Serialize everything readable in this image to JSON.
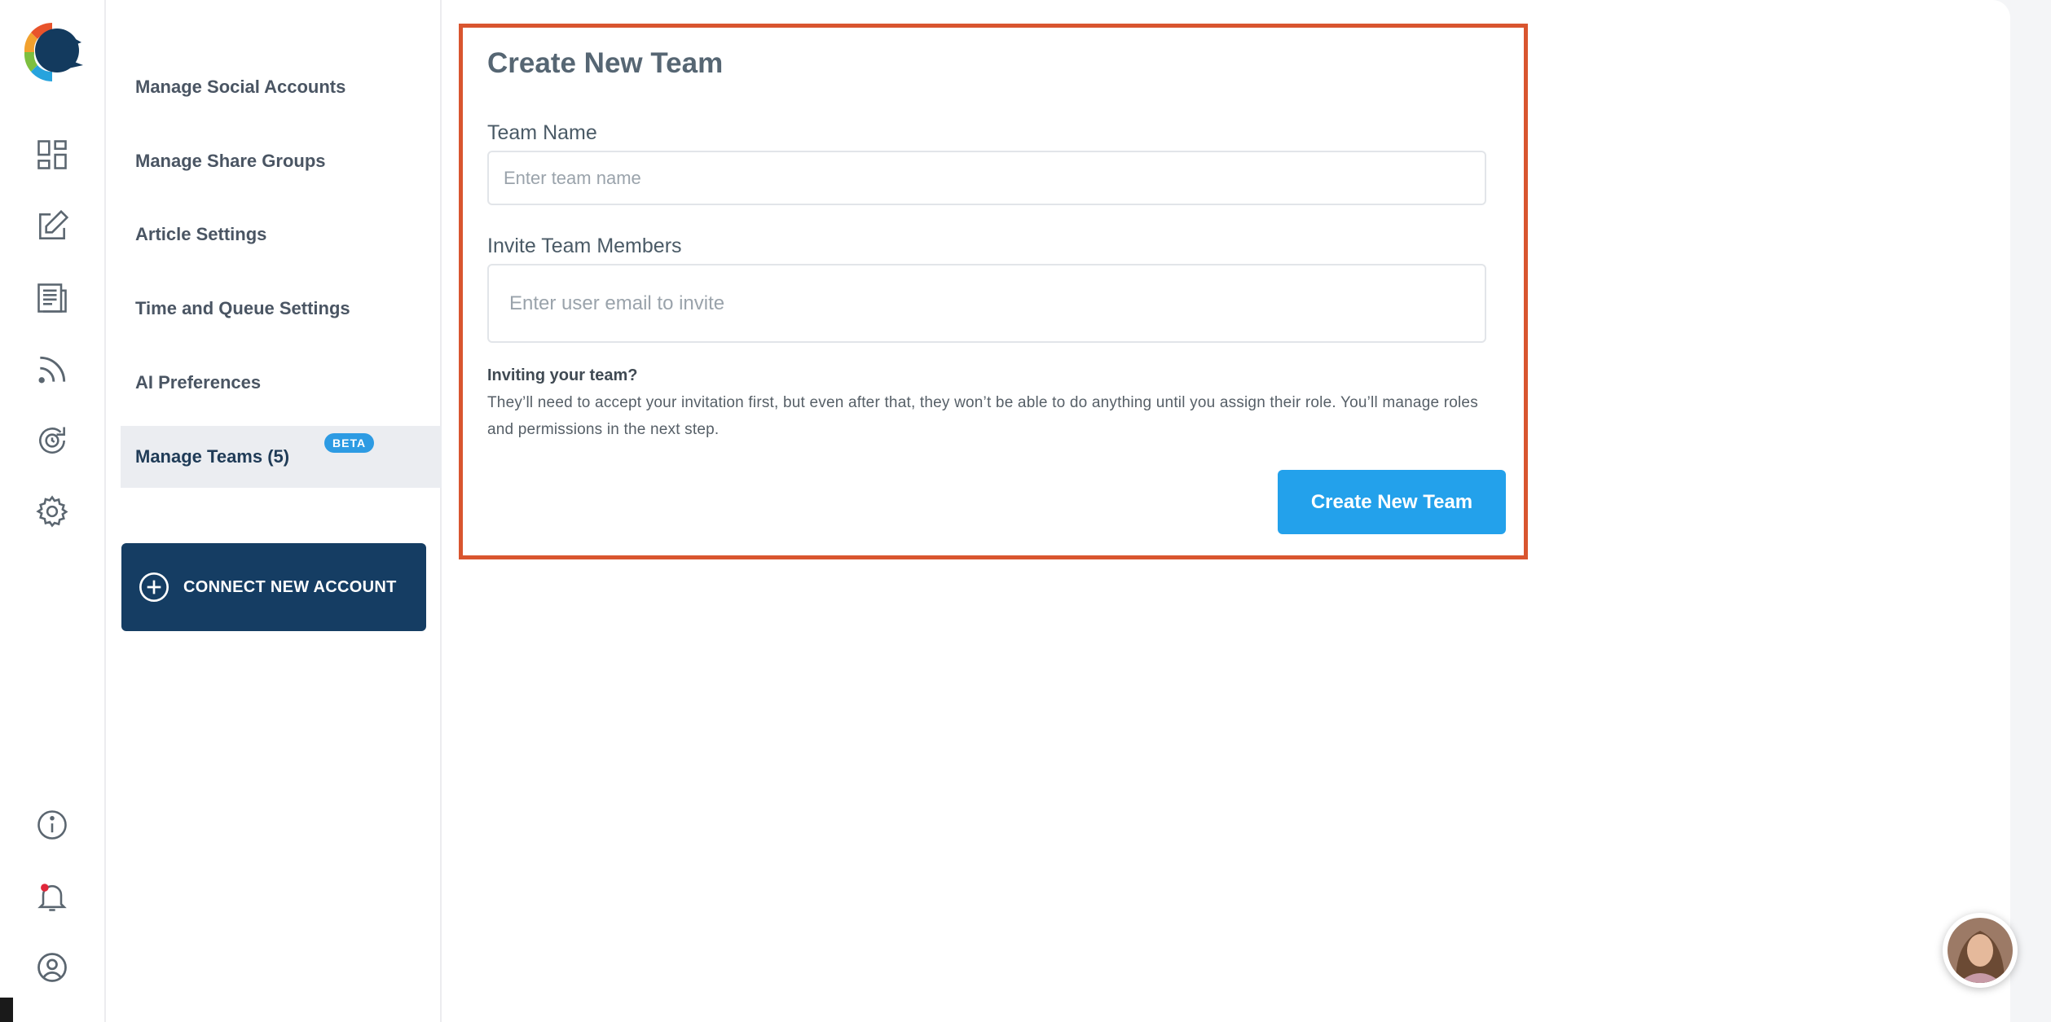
{
  "sidebar": {
    "icons": [
      {
        "name": "dashboard-icon"
      },
      {
        "name": "compose-icon"
      },
      {
        "name": "articles-icon"
      },
      {
        "name": "rss-icon"
      },
      {
        "name": "queue-icon"
      },
      {
        "name": "settings-icon"
      },
      {
        "name": "info-icon"
      },
      {
        "name": "notification-bell-icon"
      },
      {
        "name": "user-profile-icon"
      }
    ]
  },
  "nav": {
    "items": [
      {
        "label": "Manage Social Accounts"
      },
      {
        "label": "Manage Share Groups"
      },
      {
        "label": "Article Settings"
      },
      {
        "label": "Time and Queue Settings"
      },
      {
        "label": "AI Preferences"
      },
      {
        "label": "Manage Teams (5)",
        "badge": "BETA",
        "active": true
      }
    ],
    "connect_label": "CONNECT NEW ACCOUNT"
  },
  "form": {
    "title": "Create New Team",
    "team_name_label": "Team Name",
    "team_name_placeholder": "Enter team name",
    "team_name_value": "",
    "invite_label": "Invite Team Members",
    "invite_placeholder": "Enter user email to invite",
    "invite_value": "",
    "note_title": "Inviting your team?",
    "note_body": "They’ll need to accept your invitation first, but even after that, they won’t be able to do anything until you assign their role. You’ll manage roles and permissions in the next step.",
    "submit_label": "Create New Team"
  },
  "colors": {
    "accent": "#23a1eb",
    "nav_dark": "#153d63",
    "highlight_border": "#d9552f",
    "badge": "#2d9be3"
  }
}
